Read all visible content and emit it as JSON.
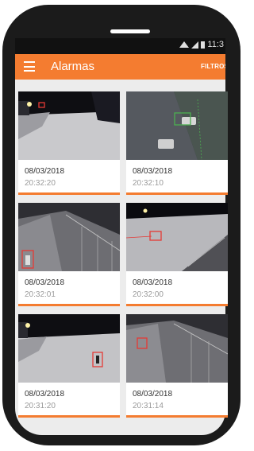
{
  "status": {
    "time": "11:3"
  },
  "appbar": {
    "title": "Alarmas",
    "filters_label": "FILTROS"
  },
  "alarms": [
    {
      "date": "08/03/2018",
      "time": "20:32:20"
    },
    {
      "date": "08/03/2018",
      "time": "20:32:10"
    },
    {
      "date": "08/03/2018",
      "time": "20:32:01"
    },
    {
      "date": "08/03/2018",
      "time": "20:32:00"
    },
    {
      "date": "08/03/2018",
      "time": "20:31:20"
    },
    {
      "date": "08/03/2018",
      "time": "20:31:14"
    }
  ],
  "colors": {
    "accent": "#f47c30",
    "detection_box": "#e53935",
    "detection_box_vehicle": "#4caf50"
  }
}
